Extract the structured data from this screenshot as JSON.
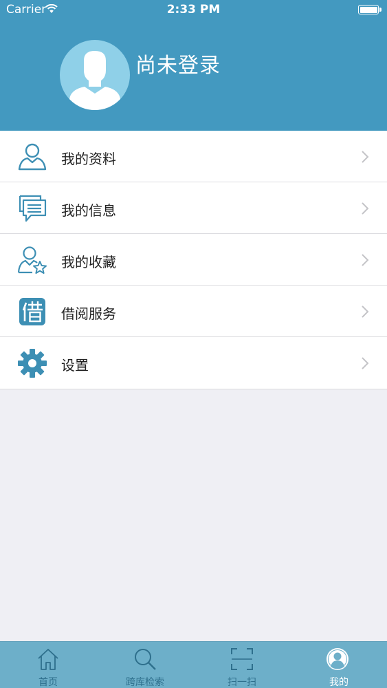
{
  "status_bar": {
    "carrier": "Carrier",
    "time": "2:33 PM"
  },
  "header": {
    "title": "尚未登录"
  },
  "menu": {
    "items": [
      {
        "label": "我的资料",
        "icon": "user-profile-icon"
      },
      {
        "label": "我的信息",
        "icon": "message-icon"
      },
      {
        "label": "我的收藏",
        "icon": "user-star-icon"
      },
      {
        "label": "借阅服务",
        "icon": "borrow-icon"
      },
      {
        "label": "设置",
        "icon": "gear-icon"
      }
    ]
  },
  "tabbar": {
    "tabs": [
      {
        "label": "首页",
        "icon": "home-icon"
      },
      {
        "label": "跨库检索",
        "icon": "search-icon"
      },
      {
        "label": "扫一扫",
        "icon": "scan-icon"
      },
      {
        "label": "我的",
        "icon": "profile-icon",
        "active": true
      }
    ]
  },
  "colors": {
    "header_bg": "#4399c0",
    "icon_blue": "#3d8fb4",
    "tabbar_bg": "#6dafc9",
    "page_bg": "#efeff4"
  }
}
